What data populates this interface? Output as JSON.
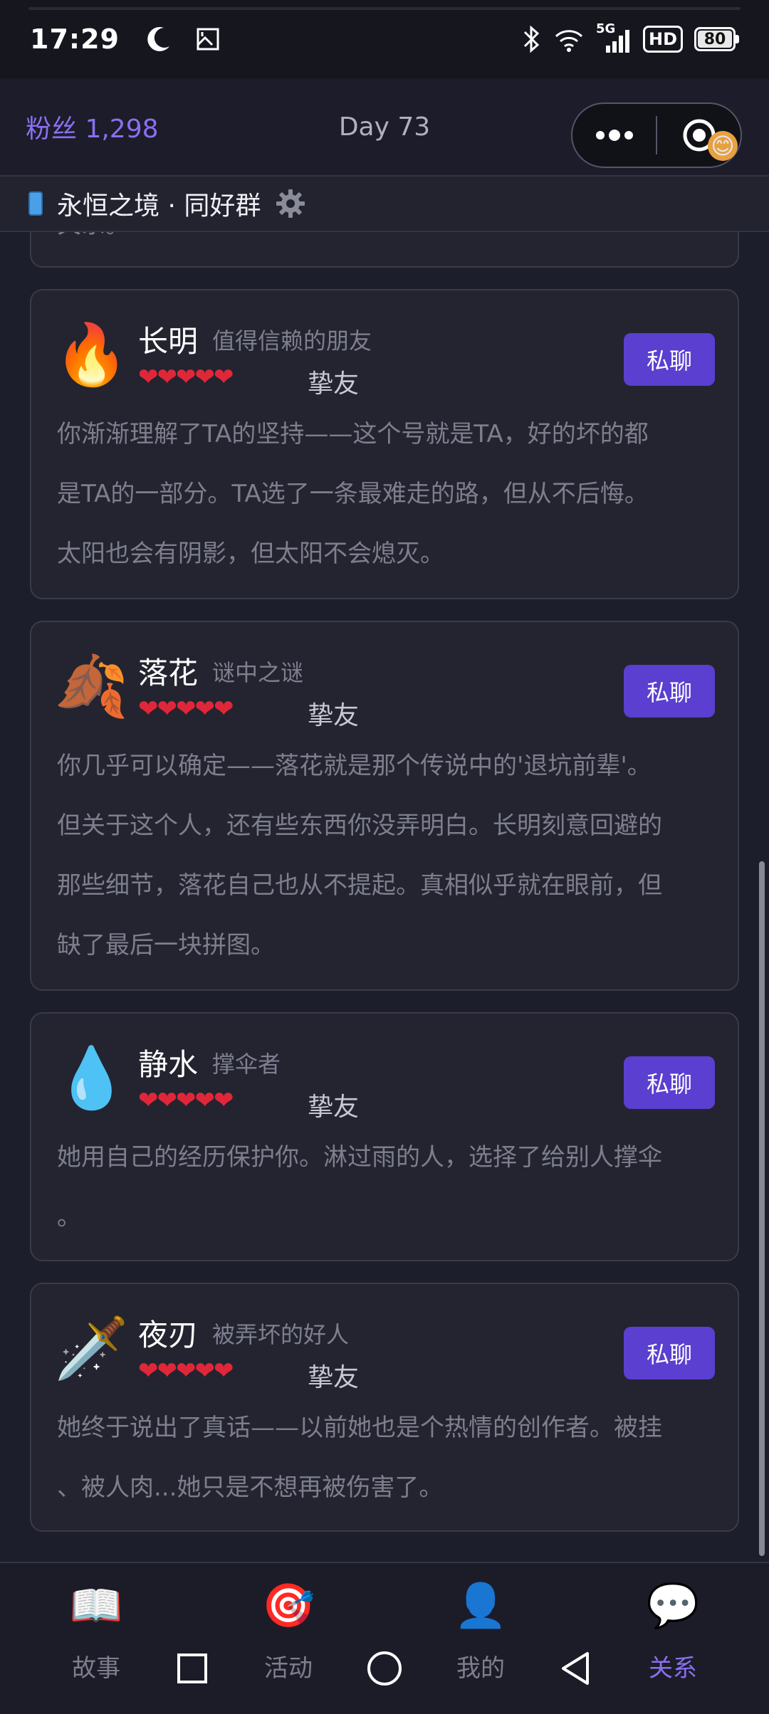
{
  "status": {
    "time": "17:29",
    "network": "5G",
    "hd": "HD",
    "battery": "80"
  },
  "header": {
    "fans_label": "粉丝 1,298",
    "day_label": "Day 73"
  },
  "group": {
    "name": "永恒之境 · 同好群",
    "prev_card_tail": "关系。"
  },
  "cards": [
    {
      "emoji": "🔥",
      "icon_name": "fire-icon",
      "name": "长明",
      "role": "值得信赖的朋友",
      "hearts": "❤❤❤❤❤",
      "level": "挚友",
      "button": "私聊",
      "lines": [
        "你渐渐理解了TA的坚持——这个号就是TA，好的坏的都",
        "是TA的一部分。TA选了一条最难走的路，但从不后悔。",
        "太阳也会有阴影，但太阳不会熄灭。"
      ]
    },
    {
      "emoji": "🍂",
      "icon_name": "fallen-leaf-icon",
      "name": "落花",
      "role": "谜中之谜",
      "hearts": "❤❤❤❤❤",
      "level": "挚友",
      "button": "私聊",
      "lines": [
        "你几乎可以确定——落花就是那个传说中的'退坑前辈'。",
        "但关于这个人，还有些东西你没弄明白。长明刻意回避的",
        "那些细节，落花自己也从不提起。真相似乎就在眼前，但",
        "缺了最后一块拼图。"
      ]
    },
    {
      "emoji": "💧",
      "icon_name": "droplet-icon",
      "name": "静水",
      "role": "撑伞者",
      "hearts": "❤❤❤❤❤",
      "level": "挚友",
      "button": "私聊",
      "lines": [
        "她用自己的经历保护你。淋过雨的人，选择了给别人撑伞",
        "。"
      ]
    },
    {
      "emoji": "🗡️",
      "icon_name": "dagger-icon",
      "name": "夜刃",
      "role": "被弄坏的好人",
      "hearts": "❤❤❤❤❤",
      "level": "挚友",
      "button": "私聊",
      "lines": [
        "她终于说出了真话——以前她也是个热情的创作者。被挂",
        "、被人肉...她只是不想再被伤害了。"
      ]
    }
  ],
  "nav": [
    {
      "label": "故事",
      "emoji": "📖",
      "icon_name": "book-icon",
      "active": false
    },
    {
      "label": "活动",
      "emoji": "🎯",
      "icon_name": "target-icon",
      "active": false
    },
    {
      "label": "我的",
      "emoji": "👤",
      "icon_name": "user-icon",
      "active": false
    },
    {
      "label": "关系",
      "emoji": "💬",
      "icon_name": "chat-bubble-icon",
      "active": true
    }
  ],
  "colors": {
    "accent": "#8a70f0",
    "button": "#5a3fd0",
    "heart": "#e0273a",
    "background": "#1d1e2c"
  }
}
